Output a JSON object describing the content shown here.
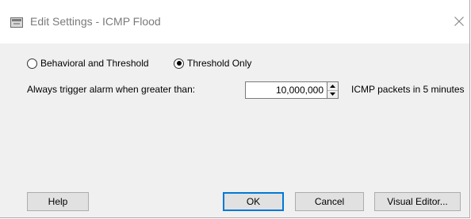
{
  "window": {
    "title": "Edit Settings - ICMP Flood",
    "icon": "settings-window-icon",
    "close_icon": "close-icon"
  },
  "mode": {
    "options": [
      {
        "label": "Behavioral and Threshold",
        "selected": false
      },
      {
        "label": "Threshold Only",
        "selected": true
      }
    ]
  },
  "alarm": {
    "label": "Always trigger alarm when greater than:",
    "value": "10,000,000",
    "unit": "ICMP packets in 5 minutes"
  },
  "buttons": {
    "help": "Help",
    "ok": "OK",
    "cancel": "Cancel",
    "visual_editor": "Visual Editor..."
  },
  "colors": {
    "dialog_bg": "#f0f0f0",
    "titlebar_bg": "#ffffff",
    "default_button_border": "#0078d7"
  }
}
